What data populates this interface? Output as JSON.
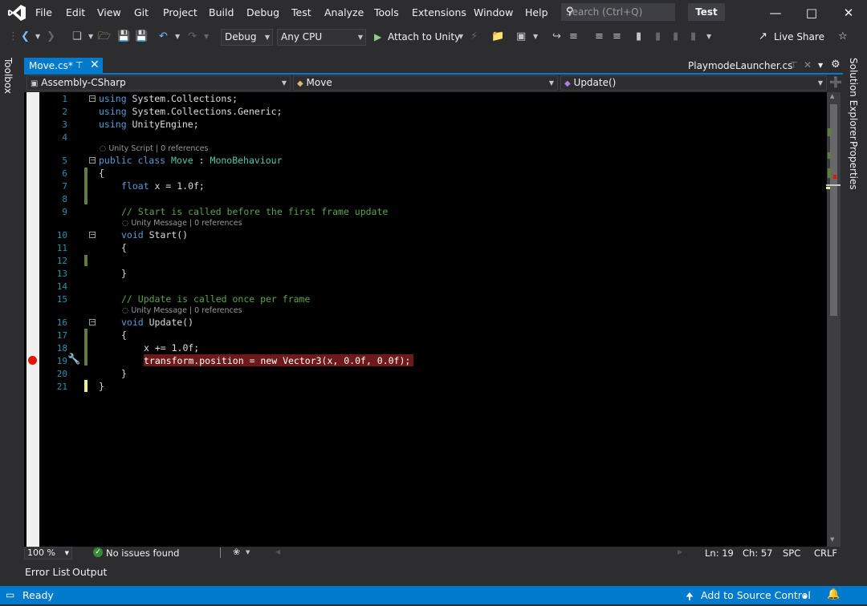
{
  "menu": [
    "File",
    "Edit",
    "View",
    "Git",
    "Project",
    "Build",
    "Debug",
    "Test",
    "Analyze",
    "Tools",
    "Extensions",
    "Window",
    "Help"
  ],
  "search": {
    "placeholder": "Search (Ctrl+Q)"
  },
  "solution_name": "Test",
  "toolbar": {
    "config": "Debug",
    "platform": "Any CPU",
    "attach_label": "Attach to Unity",
    "live_share": "Live Share"
  },
  "side": {
    "toolbox": "Toolbox",
    "solution_explorer": "Solution Explorer",
    "properties": "Properties"
  },
  "tabs": {
    "active": "Move.cs*",
    "right": "PlaymodeLauncher.cs"
  },
  "navbar": {
    "project": "Assembly-CSharp",
    "type": "Move",
    "member": "Update()"
  },
  "code": {
    "line_numbers": [
      "1",
      "2",
      "3",
      "4",
      "5",
      "6",
      "7",
      "8",
      "9",
      "10",
      "11",
      "12",
      "13",
      "14",
      "15",
      "16",
      "17",
      "18",
      "19",
      "20",
      "21"
    ],
    "lens_unity_script": "Unity Script | 0 references",
    "lens_unity_message": "Unity Message | 0 references",
    "l1_kw": "using",
    "l1_rest": " System.Collections;",
    "l2_kw": "using",
    "l2_rest": " System.Collections.Generic;",
    "l3_kw": "using",
    "l3_rest": " UnityEngine;",
    "l5_kw": "public class",
    "l5_cls": "Move",
    "l5_sep": " : ",
    "l5_base": "MonoBehaviour",
    "l6": "{",
    "l7_kw": "float",
    "l7_rest": " x = 1.0f;",
    "l9_cmt": "// Start is called before the first frame update",
    "l10_kw": "void",
    "l10_rest": " Start()",
    "l11": "{",
    "l13": "}",
    "l15_cmt": "// Update is called once per frame",
    "l16_kw": "void",
    "l16_rest": " Update()",
    "l17": "{",
    "l18": "x += 1.0f;",
    "l19": "transform.position = new Vector3(x, 0.0f, 0.0f);",
    "l20": "}",
    "l21": "}"
  },
  "editor_status": {
    "zoom": "100 %",
    "issues": "No issues found",
    "ln": "Ln: 19",
    "ch": "Ch: 57",
    "spc": "SPC",
    "eol": "CRLF"
  },
  "bottom_tabs": [
    "Error List",
    "Output"
  ],
  "statusbar": {
    "ready": "Ready",
    "source_control": "Add to Source Control"
  },
  "colors": {
    "accent": "#007acc",
    "breakpoint": "#e51400",
    "keyword": "#569cd6",
    "class": "#4ec9b0",
    "comment": "#57a64a"
  }
}
